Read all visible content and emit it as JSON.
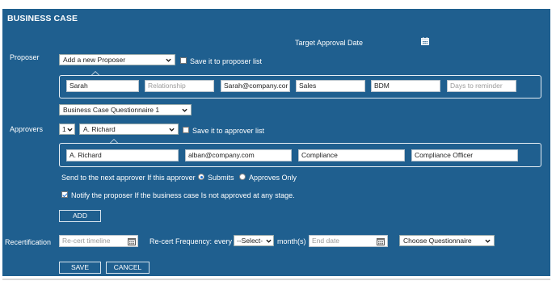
{
  "title": "BUSINESS CASE",
  "target_approval_date_label": "Target Approval Date",
  "proposer": {
    "label": "Proposer",
    "select_value": "Add a new Proposer",
    "save_label": "Save it to proposer list",
    "fields": [
      {
        "value": "Sarah",
        "placeholder": ""
      },
      {
        "value": "",
        "placeholder": "Relationship"
      },
      {
        "value": "Sarah@company.cor",
        "placeholder": ""
      },
      {
        "value": "Sales",
        "placeholder": ""
      },
      {
        "value": "BDM",
        "placeholder": ""
      },
      {
        "value": "",
        "placeholder": "Days to reminder"
      }
    ]
  },
  "questionnaire_select": "Business Case Questionnaire 1",
  "approvers": {
    "label": "Approvers",
    "order_value": "1",
    "select_value": "A. Richard",
    "save_label": "Save it to approver list",
    "fields": [
      {
        "value": "A. Richard"
      },
      {
        "value": "alban@company.com"
      },
      {
        "value": "Compliance"
      },
      {
        "value": "Compliance Officer"
      }
    ],
    "send_next_label": "Send to the next approver If this approver",
    "option_submits": "Submits",
    "option_approves": "Approves Only",
    "notify_label": "Notify the proposer If the business case Is not approved at any stage.",
    "add_button": "ADD"
  },
  "recertification": {
    "label": "Recertification",
    "timeline_placeholder": "Re-cert timeline",
    "frequency_label": "Re-cert Frequency:",
    "every_label": "every",
    "select_value": "--Select-",
    "months_label": "month(s)",
    "end_date_placeholder": "End date",
    "questionnaire_value": "Choose Questionnaire"
  },
  "buttons": {
    "save": "SAVE",
    "cancel": "CANCEL"
  },
  "colors": {
    "panel": "#1f5f8f",
    "radio_accent": "#1a6fd1"
  }
}
